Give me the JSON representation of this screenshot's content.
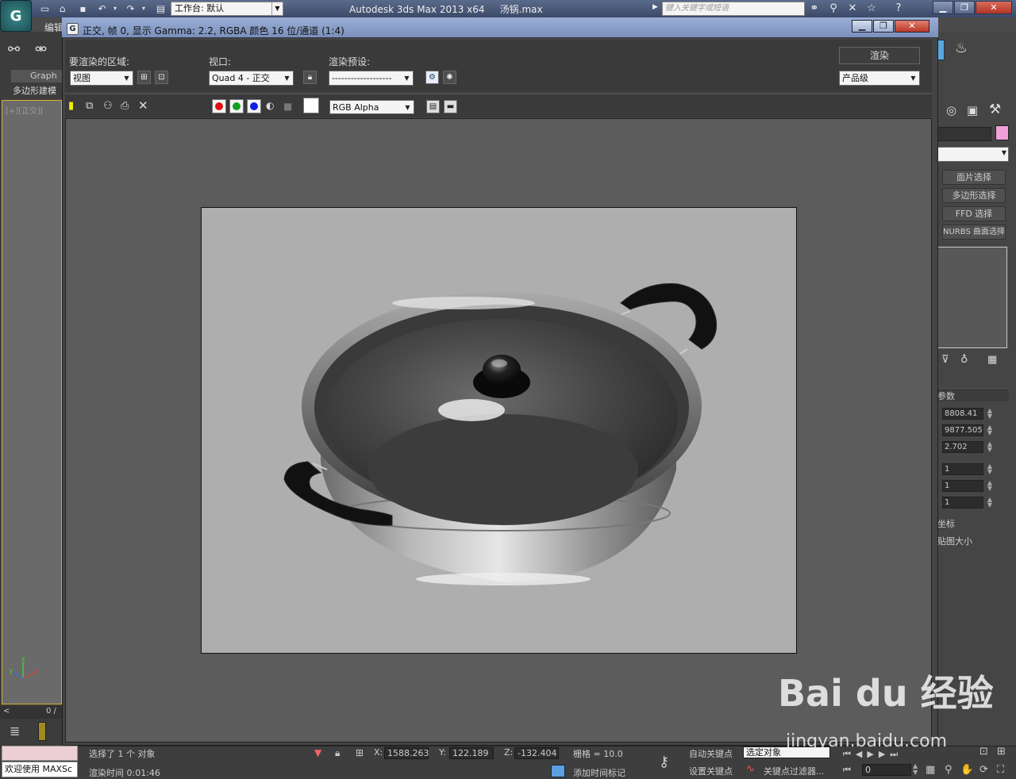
{
  "app": {
    "logo_letter": "G",
    "title": "Autodesk 3ds Max  2013 x64",
    "filename": "汤锅.max",
    "workspace_label": "工作台: 默认",
    "search_placeholder": "键入关键字或短语",
    "menu_edit": "编辑",
    "graph_tab": "Graph",
    "poly_tab": "多边形建模",
    "viewport_label": "[+][正交][",
    "axis_x": "x",
    "axis_y": "y",
    "axis_z": "z",
    "frame_counter": "0 /"
  },
  "render_window": {
    "title": "正交, 帧 0, 显示 Gamma: 2.2, RGBA 颜色 16 位/通道 (1:4)",
    "area_label": "要渲染的区域:",
    "area_value": "视图",
    "viewport_label": "视口:",
    "viewport_value": "Quad 4 - 正交",
    "preset_label": "渲染预设:",
    "preset_value": "-------------------",
    "render_button": "渲染",
    "quality_value": "产品级",
    "channel_value": "RGB Alpha",
    "colors": {
      "red": "#e01010",
      "green": "#10a020",
      "blue": "#1020e0",
      "image_bg": "#aeaeae"
    }
  },
  "command_panel": {
    "buttons": [
      "面片选择",
      "多边形选择",
      "FFD 选择",
      "NURBS 曲面选择"
    ],
    "section_label": "参数",
    "spinners": [
      "8808.41",
      "9877.505",
      "2.702",
      "1",
      "1",
      "1"
    ],
    "label_coords": "坐标",
    "label_mapsize": "贴图大小",
    "swatch_color": "#f0a0d8"
  },
  "status": {
    "selected": "选择了 1 个 对象",
    "render_time": "渲染时间  0:01:46",
    "welcome": "欢迎使用 MAXSc",
    "x_label": "X:",
    "x_value": "1588.263",
    "y_label": "Y:",
    "y_value": "122.189",
    "z_label": "Z:",
    "z_value": "-132.404",
    "grid": "栅格 = 10.0",
    "add_time_tag": "添加时间标记",
    "auto_key": "自动关键点",
    "set_key": "设置关键点",
    "selected_obj": "选定对象",
    "key_filter": "关键点过滤器...",
    "frame_value": "0"
  },
  "watermark": {
    "brand": "Bai du 经验",
    "url": "jingyan.baidu.com"
  }
}
